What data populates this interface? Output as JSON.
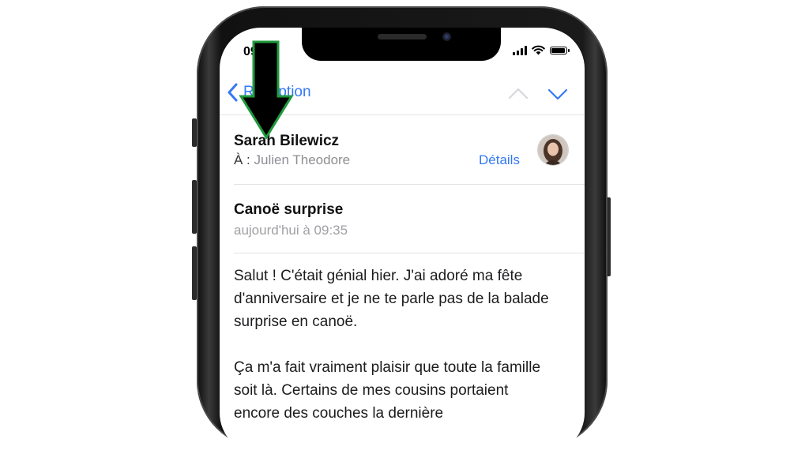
{
  "status_bar": {
    "time": "09:41"
  },
  "nav": {
    "back_label": "Réception"
  },
  "message": {
    "sender": "Sarah Bilewicz",
    "to_label": "À :",
    "recipient": "Julien Theodore",
    "details_label": "Détails",
    "subject": "Canoë surprise",
    "date": "aujourd'hui à 09:35",
    "body_paragraph_1": "Salut ! C'était génial hier. J'ai adoré ma fête d'anniversaire et je ne te parle pas de la balade surprise en canoë.",
    "body_paragraph_2": "Ça m'a fait vraiment plaisir que toute la famille soit là. Certains de mes cousins portaient encore des couches la dernière"
  },
  "colors": {
    "accent": "#3478f6",
    "annotation_arrow_fill": "#000000",
    "annotation_arrow_outline": "#1f9a3c"
  },
  "icons": {
    "back": "chevron-left-icon",
    "previous": "chevron-up-icon",
    "next": "chevron-down-icon",
    "signal": "cellular-signal-icon",
    "wifi": "wifi-icon",
    "battery": "battery-icon"
  }
}
